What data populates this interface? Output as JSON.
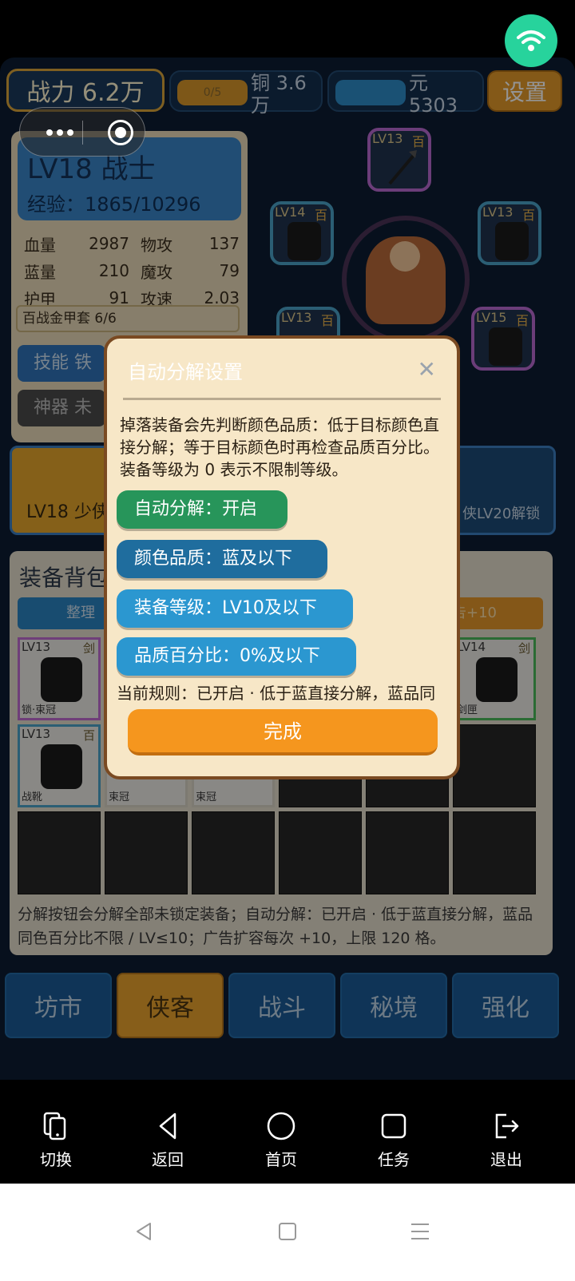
{
  "topbar": {
    "power": "战力 6.2万",
    "res1_pill": "0/5",
    "res1_text": "铜 3.6万",
    "res2_text": "元 5303",
    "settings": "设置"
  },
  "character": {
    "title": "LV18 战士",
    "exp": "经验：1865/10296",
    "stats": [
      {
        "k": "血量",
        "v": "2987",
        "k2": "物攻",
        "v2": "137"
      },
      {
        "k": "蓝量",
        "v": "210",
        "k2": "魔攻",
        "v2": "79"
      },
      {
        "k": "护甲",
        "v": "91",
        "k2": "攻速",
        "v2": "2.03"
      }
    ],
    "set_bonus": "百战金甲套 6/6",
    "skill_btn": "技能 铁",
    "artifact_btn": "神器 未"
  },
  "slots": [
    {
      "lv": "LV13",
      "q": "百"
    },
    {
      "lv": "LV14",
      "q": "百"
    },
    {
      "lv": "LV13",
      "q": "百"
    },
    {
      "lv": "LV13",
      "q": "百"
    },
    {
      "lv": "LV15",
      "q": "百"
    }
  ],
  "hero_cards": {
    "left": "LV18 少侠",
    "right": "侠LV20解锁"
  },
  "bag": {
    "title": "装备背包",
    "sort": "整理",
    "ad": "告+10",
    "items": [
      {
        "lv": "LV13",
        "q": "剑",
        "name": "锁·束冠"
      },
      {
        "lv": "LV14",
        "q": "剑",
        "name": "剑匣"
      },
      {
        "lv": "LV13",
        "q": "百",
        "name": "战靴"
      },
      {
        "lv": "",
        "q": "",
        "name": "束冠"
      },
      {
        "lv": "",
        "q": "",
        "name": "束冠"
      }
    ],
    "note": "分解按钮会分解全部未锁定装备；自动分解：已开启 · 低于蓝直接分解，蓝品同色百分比不限 / LV≤10；广告扩容每次 +10，上限 120 格。"
  },
  "tabs": [
    "坊市",
    "侠客",
    "战斗",
    "秘境",
    "强化"
  ],
  "modal": {
    "title": "自动分解设置",
    "close": "✕",
    "desc": "掉落装备会先判断颜色品质：低于目标颜色直接分解；等于目标颜色时再检查品质百分比。装备等级为 0 表示不限制等级。",
    "opt_auto": "自动分解：开启",
    "opt_color": "颜色品质：蓝及以下",
    "opt_level": "装备等级：LV10及以下",
    "opt_percent": "品质百分比：0%及以下",
    "rule": "当前规则：已开启 · 低于蓝直接分解，蓝品同",
    "done": "完成"
  },
  "toolbar": [
    "切换",
    "返回",
    "首页",
    "任务",
    "退出"
  ],
  "colors": {
    "accent_orange": "#f5961e",
    "accent_green": "#27955a",
    "accent_blue": "#2b97d0",
    "wifi": "#27d39c"
  }
}
